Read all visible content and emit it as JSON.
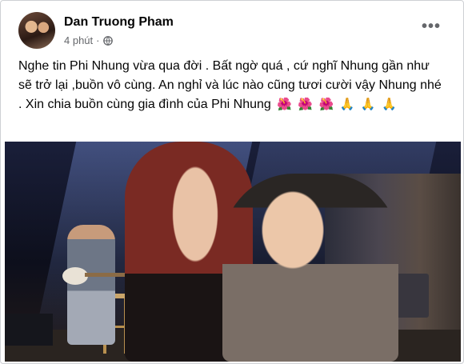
{
  "post": {
    "author": "Dan Truong Pham",
    "time": "4 phút",
    "separator": "·",
    "more_label": "•••",
    "text": "Nghe tin Phi Nhung vừa qua đời . Bất ngờ quá , cứ nghĩ Nhung gần như sẽ trở lại ,buồn vô cùng.  An nghỉ và lúc nào cũng tươi cười vậy Nhung nhé . Xin chia buồn cùng gia đình của Phi Nhung",
    "emojis": [
      "🌺",
      "🌺",
      "🌺",
      "🙏",
      "🙏",
      "🙏"
    ]
  },
  "icons": {
    "globe": "globe-icon",
    "more": "more-options-icon"
  },
  "colors": {
    "text": "#050505",
    "meta": "#65676b",
    "border": "#ced0d4"
  }
}
